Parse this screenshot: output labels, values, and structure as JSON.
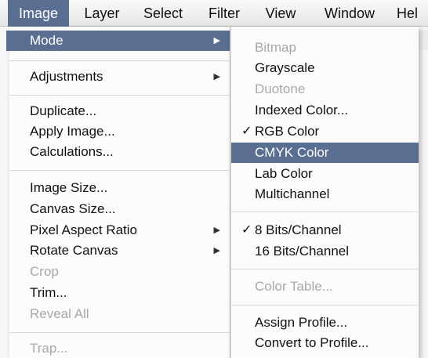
{
  "menubar": {
    "items": [
      "Image",
      "Layer",
      "Select",
      "Filter",
      "View",
      "Window",
      "Hel"
    ],
    "active_index": 0
  },
  "image_menu": {
    "items": [
      {
        "label": "Mode",
        "submenu": true,
        "highlighted": true
      },
      {
        "label": "Adjustments",
        "submenu": true
      },
      {
        "label": "Duplicate..."
      },
      {
        "label": "Apply Image..."
      },
      {
        "label": "Calculations..."
      },
      {
        "label": "Image Size..."
      },
      {
        "label": "Canvas Size..."
      },
      {
        "label": "Pixel Aspect Ratio",
        "submenu": true
      },
      {
        "label": "Rotate Canvas",
        "submenu": true
      },
      {
        "label": "Crop",
        "disabled": true
      },
      {
        "label": "Trim..."
      },
      {
        "label": "Reveal All",
        "disabled": true
      },
      {
        "label": "Trap...",
        "disabled": true
      }
    ]
  },
  "mode_submenu": {
    "items": [
      {
        "label": "Bitmap",
        "disabled": true
      },
      {
        "label": "Grayscale"
      },
      {
        "label": "Duotone",
        "disabled": true
      },
      {
        "label": "Indexed Color..."
      },
      {
        "label": "RGB Color",
        "checked": true
      },
      {
        "label": "CMYK Color",
        "highlighted": true
      },
      {
        "label": "Lab Color"
      },
      {
        "label": "Multichannel"
      },
      {
        "label": "8 Bits/Channel",
        "checked": true
      },
      {
        "label": "16 Bits/Channel"
      },
      {
        "label": "Color Table...",
        "disabled": true
      },
      {
        "label": "Assign Profile..."
      },
      {
        "label": "Convert to Profile..."
      }
    ]
  },
  "glyphs": {
    "arrow": "▶",
    "check": "✓"
  },
  "colors": {
    "highlight": "#5a6e92",
    "disabled_text": "#a8a8a8"
  }
}
